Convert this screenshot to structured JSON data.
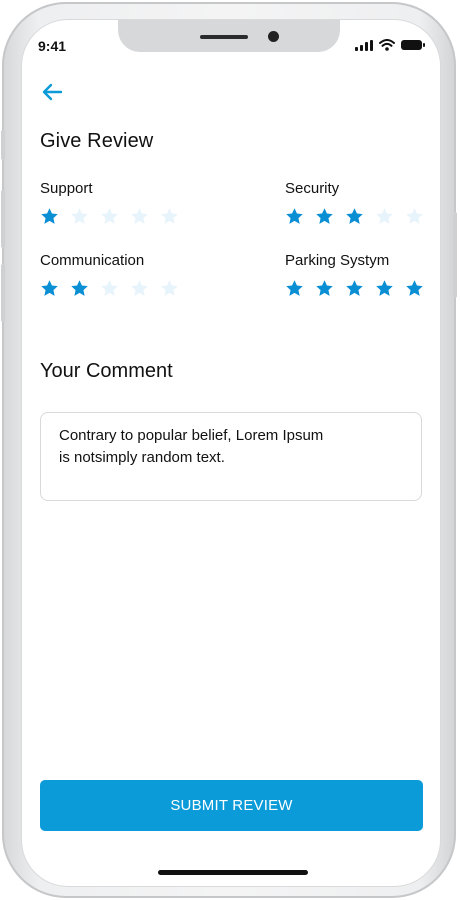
{
  "status_bar": {
    "time": "9:41"
  },
  "header": {
    "back_icon": "arrow-left-icon",
    "title": "Give Review"
  },
  "ratings": [
    {
      "label": "Support",
      "score": 1,
      "max": 5
    },
    {
      "label": "Security",
      "score": 3,
      "max": 5
    },
    {
      "label": "Communication",
      "score": 2,
      "max": 5
    },
    {
      "label": "Parking Systym",
      "score": 5,
      "max": 5
    }
  ],
  "comment": {
    "title": "Your Comment",
    "text_line1": "Contrary to popular belief, Lorem Ipsum",
    "text_line2": "is notsimply random text."
  },
  "submit_label": "SUBMIT REVIEW",
  "colors": {
    "accent": "#0b9bd8",
    "star_filled": "#0b8fd4",
    "star_empty": "#e8f4fb"
  }
}
